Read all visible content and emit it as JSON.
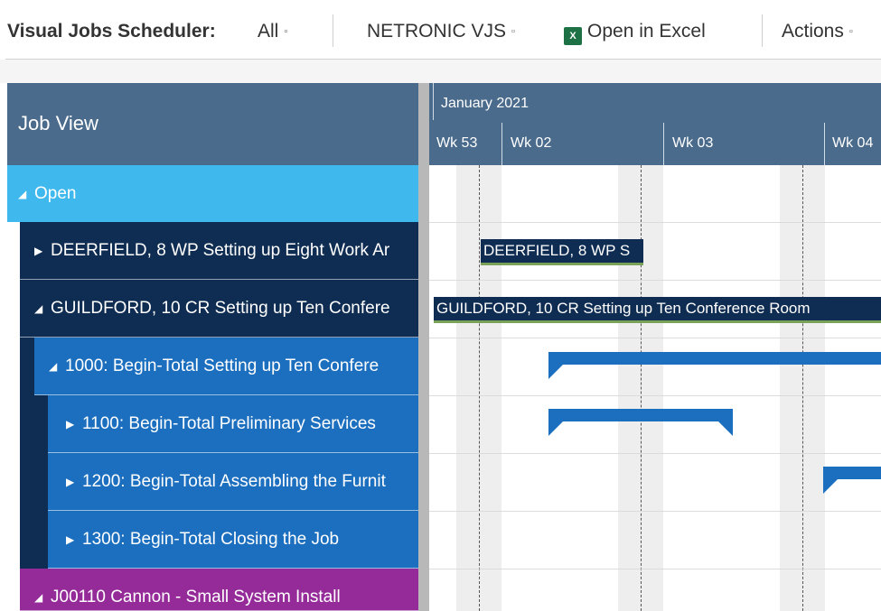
{
  "toolbar": {
    "title": "Visual Jobs Scheduler:",
    "filter": "All",
    "netronic": "NETRONIC VJS",
    "excel": "Open in Excel",
    "actions": "Actions",
    "caret": "▫"
  },
  "left_panel": {
    "header": "Job View",
    "open_group": "Open",
    "rows": [
      {
        "label": "DEERFIELD, 8 WP Setting up Eight Work Ar",
        "expanded": false
      },
      {
        "label": "GUILDFORD, 10 CR Setting up Ten Confere",
        "expanded": true
      },
      {
        "label": "1000: Begin-Total Setting up Ten Confere",
        "expanded": true
      },
      {
        "label": "1100: Begin-Total Preliminary Services",
        "expanded": false
      },
      {
        "label": "1200: Begin-Total Assembling the Furnit",
        "expanded": false
      },
      {
        "label": "1300: Begin-Total Closing the Job",
        "expanded": false
      },
      {
        "label": "J00110 Cannon - Small System Install",
        "expanded": true
      }
    ]
  },
  "gantt": {
    "month": "January 2021",
    "weeks": [
      "Wk 53",
      "Wk 02",
      "Wk 03",
      "Wk 04"
    ],
    "bars": {
      "deerfield": "DEERFIELD, 8 WP S",
      "guildford": "GUILDFORD, 10 CR Setting up Ten Conference Room"
    }
  },
  "icons": {
    "expanded": "◢",
    "collapsed": "▶"
  },
  "colors": {
    "header": "#4a6b8c",
    "open_group": "#3fb8ee",
    "job": "#0f2d52",
    "task": "#1c6fbf",
    "job_cannon": "#952a99",
    "bar_progress": "#7aa05a",
    "filter_link": "#0f7b7b",
    "excel": "#1e7145"
  }
}
